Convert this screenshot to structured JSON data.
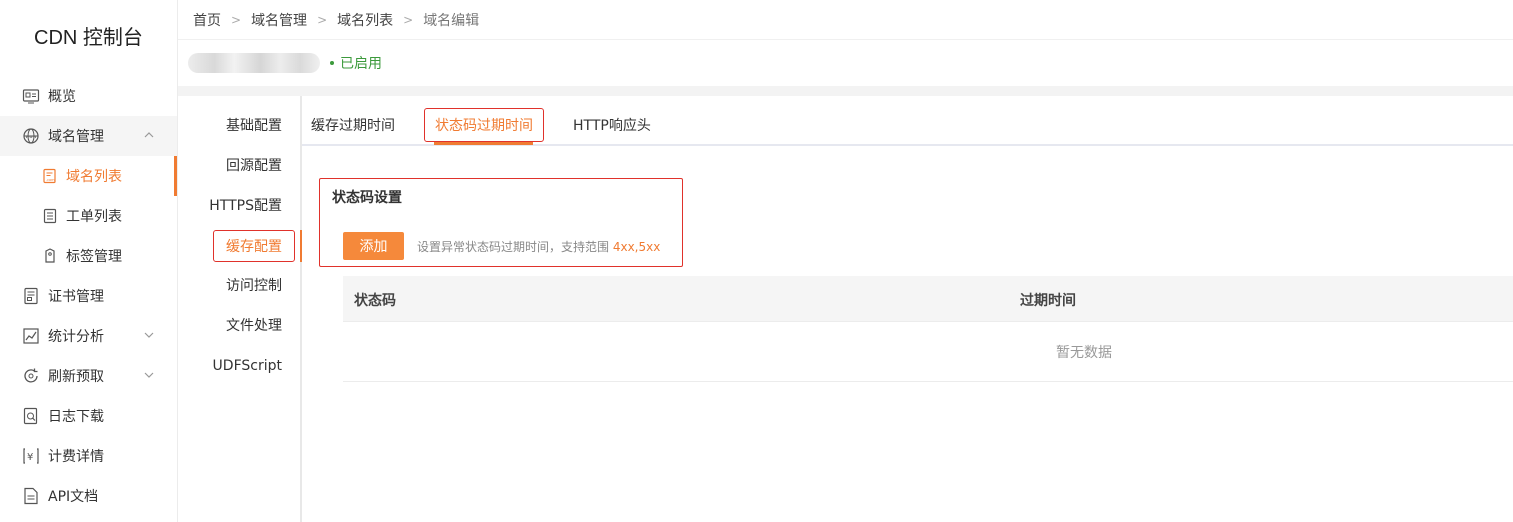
{
  "sidebar": {
    "logo": "CDN 控制台",
    "items": [
      {
        "label": "概览"
      },
      {
        "label": "域名管理"
      },
      {
        "label": "域名列表"
      },
      {
        "label": "工单列表"
      },
      {
        "label": "标签管理"
      },
      {
        "label": "证书管理"
      },
      {
        "label": "统计分析"
      },
      {
        "label": "刷新预取"
      },
      {
        "label": "日志下载"
      },
      {
        "label": "计费详情"
      },
      {
        "label": "API文档"
      }
    ]
  },
  "breadcrumb": [
    "首页",
    "域名管理",
    "域名列表",
    "域名编辑"
  ],
  "domain": {
    "status": "已启用"
  },
  "config_menu": [
    "基础配置",
    "回源配置",
    "HTTPS配置",
    "缓存配置",
    "访问控制",
    "文件处理",
    "UDFScript"
  ],
  "tabs": [
    "缓存过期时间",
    "状态码过期时间",
    "HTTP响应头"
  ],
  "panel": {
    "title": "状态码设置",
    "add_label": "添加",
    "hint_text": "设置异常状态码过期时间，支持范围 ",
    "hint_range": "4xx,5xx"
  },
  "table": {
    "columns": [
      "状态码",
      "过期时间"
    ],
    "empty_text": "暂无数据"
  },
  "colors": {
    "accent": "#f07b32",
    "highlight_border": "#e0322b",
    "status_green": "#3c9a3c"
  }
}
